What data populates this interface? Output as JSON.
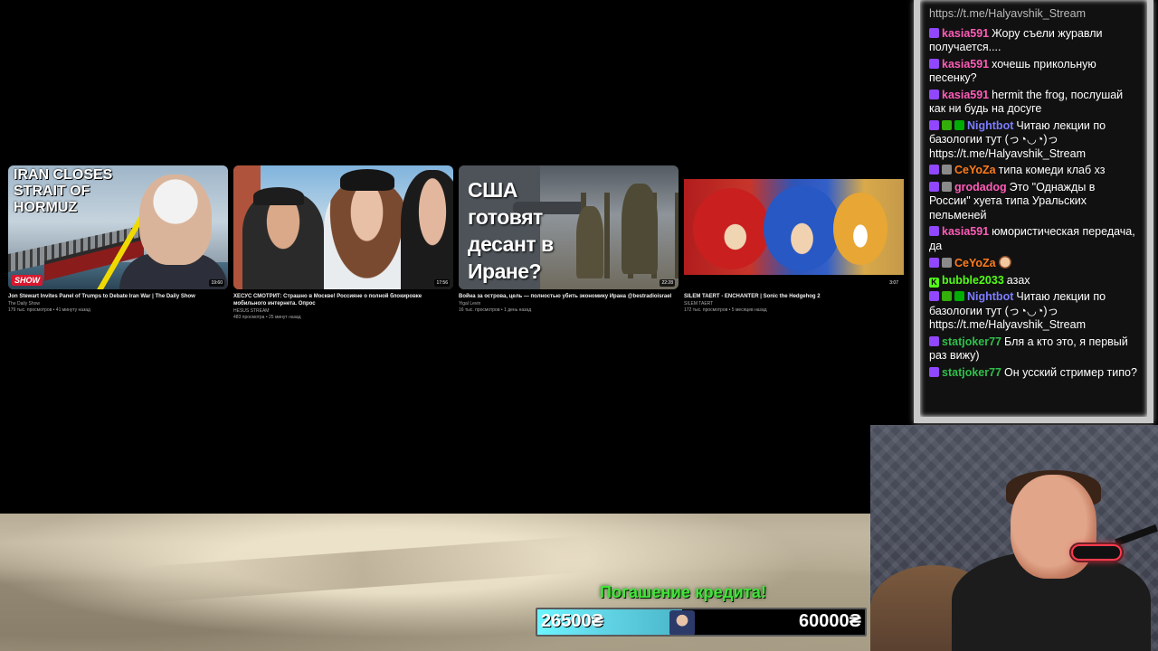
{
  "videos": [
    {
      "title": "Jon Stewart Invites Panel of Trumps to Debate Iran War | The Daily Show",
      "channel": "The Daily Show",
      "meta": "179 тыс. просмотров • 41 минуту назад",
      "duration": "19:60",
      "thumb_text": "IRAN CLOSES STRAIT OF HORMUZ",
      "thumb_logo": "SHOW"
    },
    {
      "title": "ХЕСУС СМОТРИТ: Страшно в Москве! Россияне о полной блокировке мобильного интернета. Опрос",
      "channel": "HESUS STREAM",
      "meta": "483 просмотра • 25 минут назад",
      "duration": "17:56"
    },
    {
      "title": "Война за острова, цель — полностью убить экономику Ирана @bestradioisrael",
      "channel": "Yigal Levin",
      "meta": "16 тыс. просмотров • 1 день назад",
      "duration": "22:28",
      "thumb_text": "США готовят десант в Иране?"
    },
    {
      "title": "SILEM TAERT - ENCHANTER | Sonic the Hedgehog 2",
      "channel": "SILEM TAERT",
      "meta": "172 тыс. просмотров • 5 месяцев назад",
      "duration": "3:07"
    }
  ],
  "chat": {
    "top_line": "https://t.me/Halyavshik_Stream",
    "messages": [
      {
        "user": "kasia591",
        "color": "#ff5cb8",
        "badges": [
          "twitch"
        ],
        "text": "Жору съели журавли получается...."
      },
      {
        "user": "kasia591",
        "color": "#ff5cb8",
        "badges": [
          "twitch"
        ],
        "text": "хочешь прикольную песенку?"
      },
      {
        "user": "kasia591",
        "color": "#ff5cb8",
        "badges": [
          "twitch"
        ],
        "text": "hermit the frog, послушай как ни будь на досуге"
      },
      {
        "user": "Nightbot",
        "color": "#7c7cff",
        "badges": [
          "twitch",
          "mod",
          "green"
        ],
        "text": "Читаю лекции по базологии тут (っ◔◡◔)っ https://t.me/Halyavshik_Stream"
      },
      {
        "user": "CeYoZa",
        "color": "#ff7a1a",
        "badges": [
          "twitch",
          "grey"
        ],
        "text": "типа комеди клаб хз"
      },
      {
        "user": "grodadog",
        "color": "#ff5cb8",
        "badges": [
          "twitch",
          "grey"
        ],
        "text": "Это \"Однажды в России\" хуета типа Уральских пельменей"
      },
      {
        "user": "kasia591",
        "color": "#ff5cb8",
        "badges": [
          "twitch"
        ],
        "text": "юмористическая передача, да"
      },
      {
        "user": "CeYoZa",
        "color": "#ff7a1a",
        "badges": [
          "twitch",
          "grey"
        ],
        "text": "",
        "emote": true
      },
      {
        "user": "bubble2033",
        "color": "#53fc18",
        "badges": [
          "kick"
        ],
        "text": "азах"
      },
      {
        "user": "Nightbot",
        "color": "#7c7cff",
        "badges": [
          "twitch",
          "mod",
          "green"
        ],
        "text": "Читаю лекции по базологии тут (っ◔◡◔)っ https://t.me/Halyavshik_Stream"
      },
      {
        "user": "statjoker77",
        "color": "#2fbf4a",
        "badges": [
          "twitch"
        ],
        "text": "Бля а кто это, я первый раз вижу)"
      },
      {
        "user": "statjoker77",
        "color": "#2fbf4a",
        "badges": [
          "twitch"
        ],
        "text": "Он усский стример типо?"
      }
    ]
  },
  "goal": {
    "title": "Погашение кредита!",
    "current": "26500₴",
    "target": "60000₴",
    "progress": 0.4417
  },
  "colors": {
    "goal_title": "#41e43a",
    "goal_fill": "#63d8e8",
    "background": "#000000"
  }
}
